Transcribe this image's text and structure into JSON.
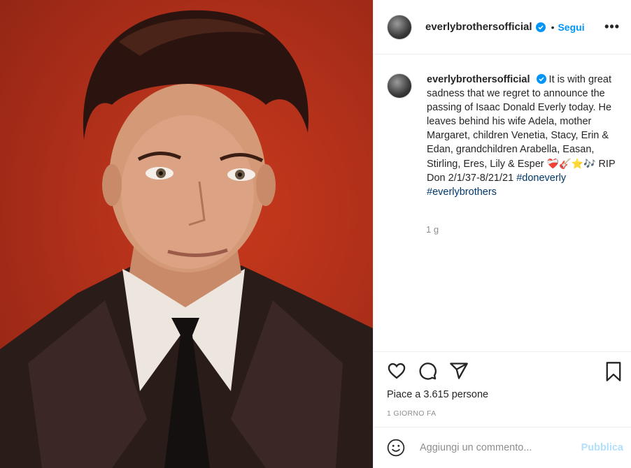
{
  "post": {
    "username": "everlybrothersofficial",
    "follow_label": "Segui",
    "separator": "•",
    "more_label": "•••",
    "caption_text": "It is with great sadness that we regret to announce the passing of Isaac Donald Everly today. He leaves behind his wife Adela, mother Margaret, children Venetia, Stacy, Erin & Edan, grandchildren Arabella, Easan, Stirling, Eres, Lily & Esper",
    "caption_emojis": [
      "❤️‍🩹",
      "🎸",
      "⭐",
      "🎶"
    ],
    "caption_tail": "RIP Don 2/1/37-8/21/21",
    "hashtags": [
      "#doneverly",
      "#everlybrothers"
    ],
    "caption_time": "1 g",
    "likes_text": "Piace a 3.615 persone",
    "time_ago": "1 GIORNO FA",
    "comment_placeholder": "Aggiungi un commento...",
    "publish_label": "Pubblica",
    "icons": [
      "verified-badge-icon",
      "heart-icon",
      "comment-icon",
      "share-icon",
      "save-icon",
      "emoji-icon"
    ],
    "colors": {
      "accent": "#0095f6",
      "hashtag": "#00376b",
      "muted": "#8e8e8e",
      "publish_disabled": "#b2dffc",
      "photo_bg": "#b1301a"
    }
  }
}
